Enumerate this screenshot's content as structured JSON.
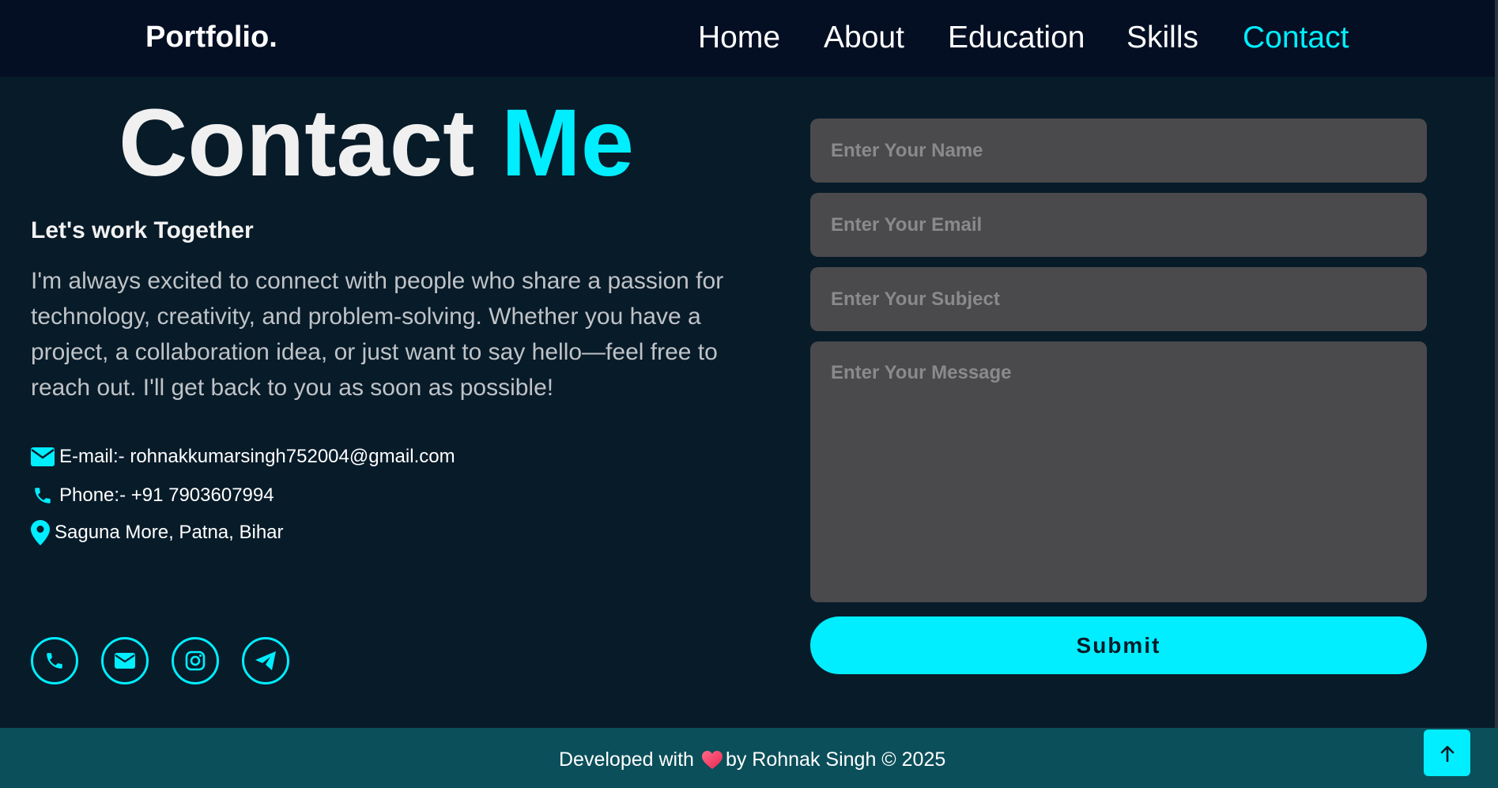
{
  "header": {
    "logo": "Portfolio.",
    "nav": [
      {
        "label": "Home"
      },
      {
        "label": "About"
      },
      {
        "label": "Education"
      },
      {
        "label": "Skills"
      },
      {
        "label": "Contact"
      }
    ],
    "active_nav": "Contact"
  },
  "contact": {
    "title_part1": "Contact",
    "title_part2": "Me",
    "subheading": "Let's work Together",
    "paragraph": "I'm always excited to connect with people who share a passion for technology, creativity, and problem-solving. Whether you have a project, a collaboration idea, or just want to say hello—feel free to reach out. I'll get back to you as soon as possible!",
    "email_line": "E-mail:- rohnakkumarsingh752004@gmail.com",
    "phone_line": "Phone:- +91 7903607994",
    "location_line": "Saguna More, Patna, Bihar",
    "socials": [
      "phone-icon",
      "mail-icon",
      "instagram-icon",
      "telegram-icon"
    ]
  },
  "form": {
    "name_placeholder": "Enter Your Name",
    "email_placeholder": "Enter Your Email",
    "subject_placeholder": "Enter Your Subject",
    "message_placeholder": "Enter Your Message",
    "submit_label": "Submit"
  },
  "footer": {
    "text_before": "Developed with",
    "text_after": "by Rohnak Singh © 2025"
  },
  "colors": {
    "accent": "#00eeff",
    "background": "#081b29",
    "header_bg": "#050f24",
    "footer_bg": "#0b4f5a",
    "field_bg": "#4a4a4c"
  }
}
